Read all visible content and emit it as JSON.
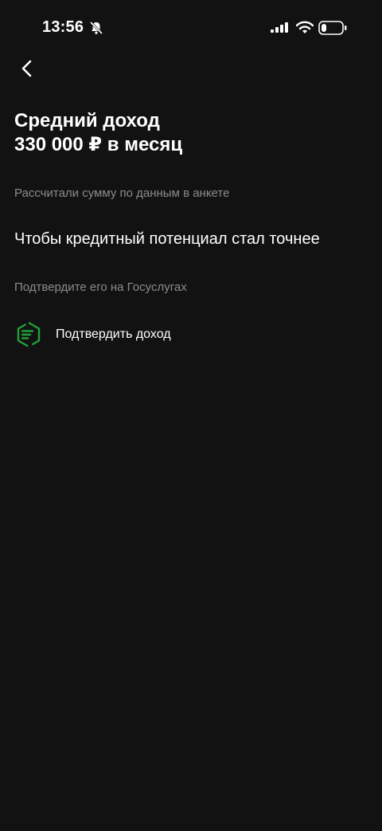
{
  "status_bar": {
    "time": "13:56",
    "icons": [
      "bell-muted-icon",
      "signal-icon",
      "wifi-icon",
      "battery-icon"
    ],
    "battery_level": 0.25
  },
  "nav": {
    "back_icon": "chevron-left-icon"
  },
  "header": {
    "title_line1": "Средний доход",
    "title_line2": "330 000 ₽ в месяц",
    "subtitle": "Рассчитали сумму по данным в анкете"
  },
  "section": {
    "title": "Чтобы кредитный потенциал стал точнее",
    "subtitle": "Подтвердите его на Госуслугах"
  },
  "action": {
    "icon": "gosuslugi-icon",
    "label": "Подтвердить доход"
  },
  "colors": {
    "background": "#121212",
    "text_primary": "#ffffff",
    "text_secondary": "#8c8c8c",
    "accent_green": "#21a038"
  }
}
